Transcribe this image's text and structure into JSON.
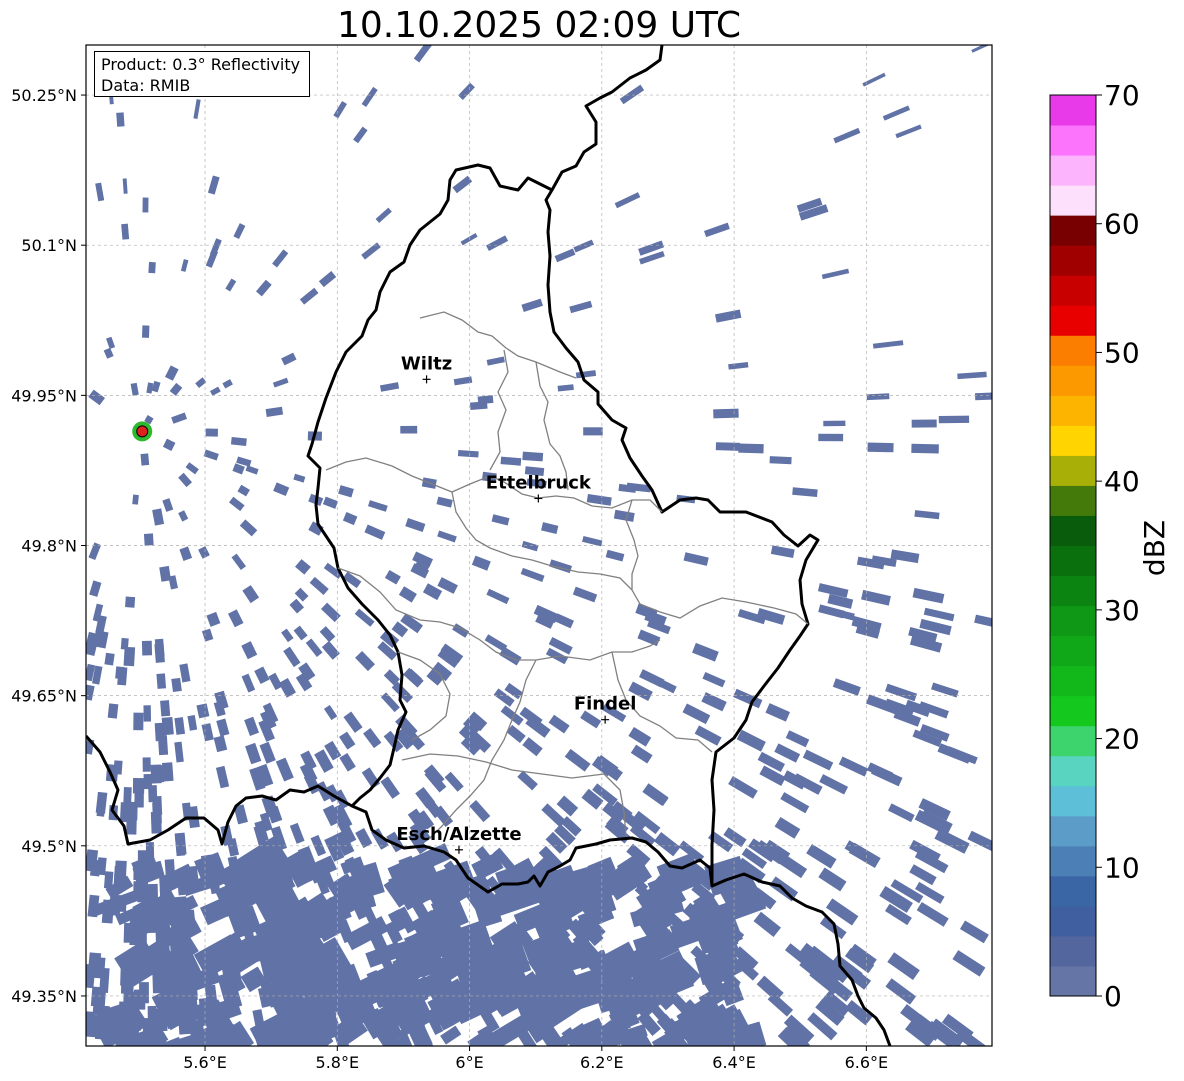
{
  "title": "10.10.2025 02:09 UTC",
  "info": {
    "product": "Product: 0.3° Reflectivity",
    "data": "Data: RMIB"
  },
  "lat_ticks": [
    {
      "value": 50.25,
      "label": "50.25°N"
    },
    {
      "value": 50.1,
      "label": "50.1°N"
    },
    {
      "value": 49.95,
      "label": "49.95°N"
    },
    {
      "value": 49.8,
      "label": "49.8°N"
    },
    {
      "value": 49.65,
      "label": "49.65°N"
    },
    {
      "value": 49.5,
      "label": "49.5°N"
    },
    {
      "value": 49.35,
      "label": "49.35°N"
    }
  ],
  "lon_ticks": [
    {
      "value": 5.6,
      "label": "5.6°E"
    },
    {
      "value": 5.8,
      "label": "5.8°E"
    },
    {
      "value": 6.0,
      "label": "6°E"
    },
    {
      "value": 6.2,
      "label": "6.2°E"
    },
    {
      "value": 6.4,
      "label": "6.4°E"
    },
    {
      "value": 6.6,
      "label": "6.6°E"
    }
  ],
  "extent": {
    "lon_min": 5.42,
    "lon_max": 6.79,
    "lat_min": 49.3,
    "lat_max": 50.3
  },
  "cities": [
    {
      "name": "Wiltz",
      "lon": 5.935,
      "lat": 49.966
    },
    {
      "name": "Ettelbruck",
      "lon": 6.104,
      "lat": 49.847
    },
    {
      "name": "Findel",
      "lon": 6.205,
      "lat": 49.626
    },
    {
      "name": "Esch/Alzette",
      "lon": 5.984,
      "lat": 49.496
    }
  ],
  "radar": {
    "lon": 5.505,
    "lat": 49.914,
    "color": "#e02020",
    "halo_color": "#2eb82e"
  },
  "colorbar": {
    "title": "dBZ",
    "min": 0,
    "max": 70,
    "ticks": [
      0,
      10,
      20,
      30,
      40,
      50,
      60,
      70
    ],
    "colors": [
      "#6475a6",
      "#53669e",
      "#3f5fa0",
      "#3b66a6",
      "#4b7fb6",
      "#5b9dc8",
      "#5dc0d8",
      "#59d4c0",
      "#3dd46e",
      "#14c81e",
      "#12b81a",
      "#10a818",
      "#0e9816",
      "#0c8412",
      "#0a700e",
      "#085c0c",
      "#447a0a",
      "#a8b008",
      "#ffd400",
      "#fcb400",
      "#fc9800",
      "#fc7e00",
      "#e80000",
      "#c80000",
      "#a00000",
      "#780000",
      "#fce0fc",
      "#fcb4fc",
      "#fc74fc",
      "#e83ae8"
    ]
  },
  "colors": {
    "rain": "#6072a6",
    "border": "#000000",
    "canton": "#808080",
    "grid": "#b0b0b0"
  }
}
